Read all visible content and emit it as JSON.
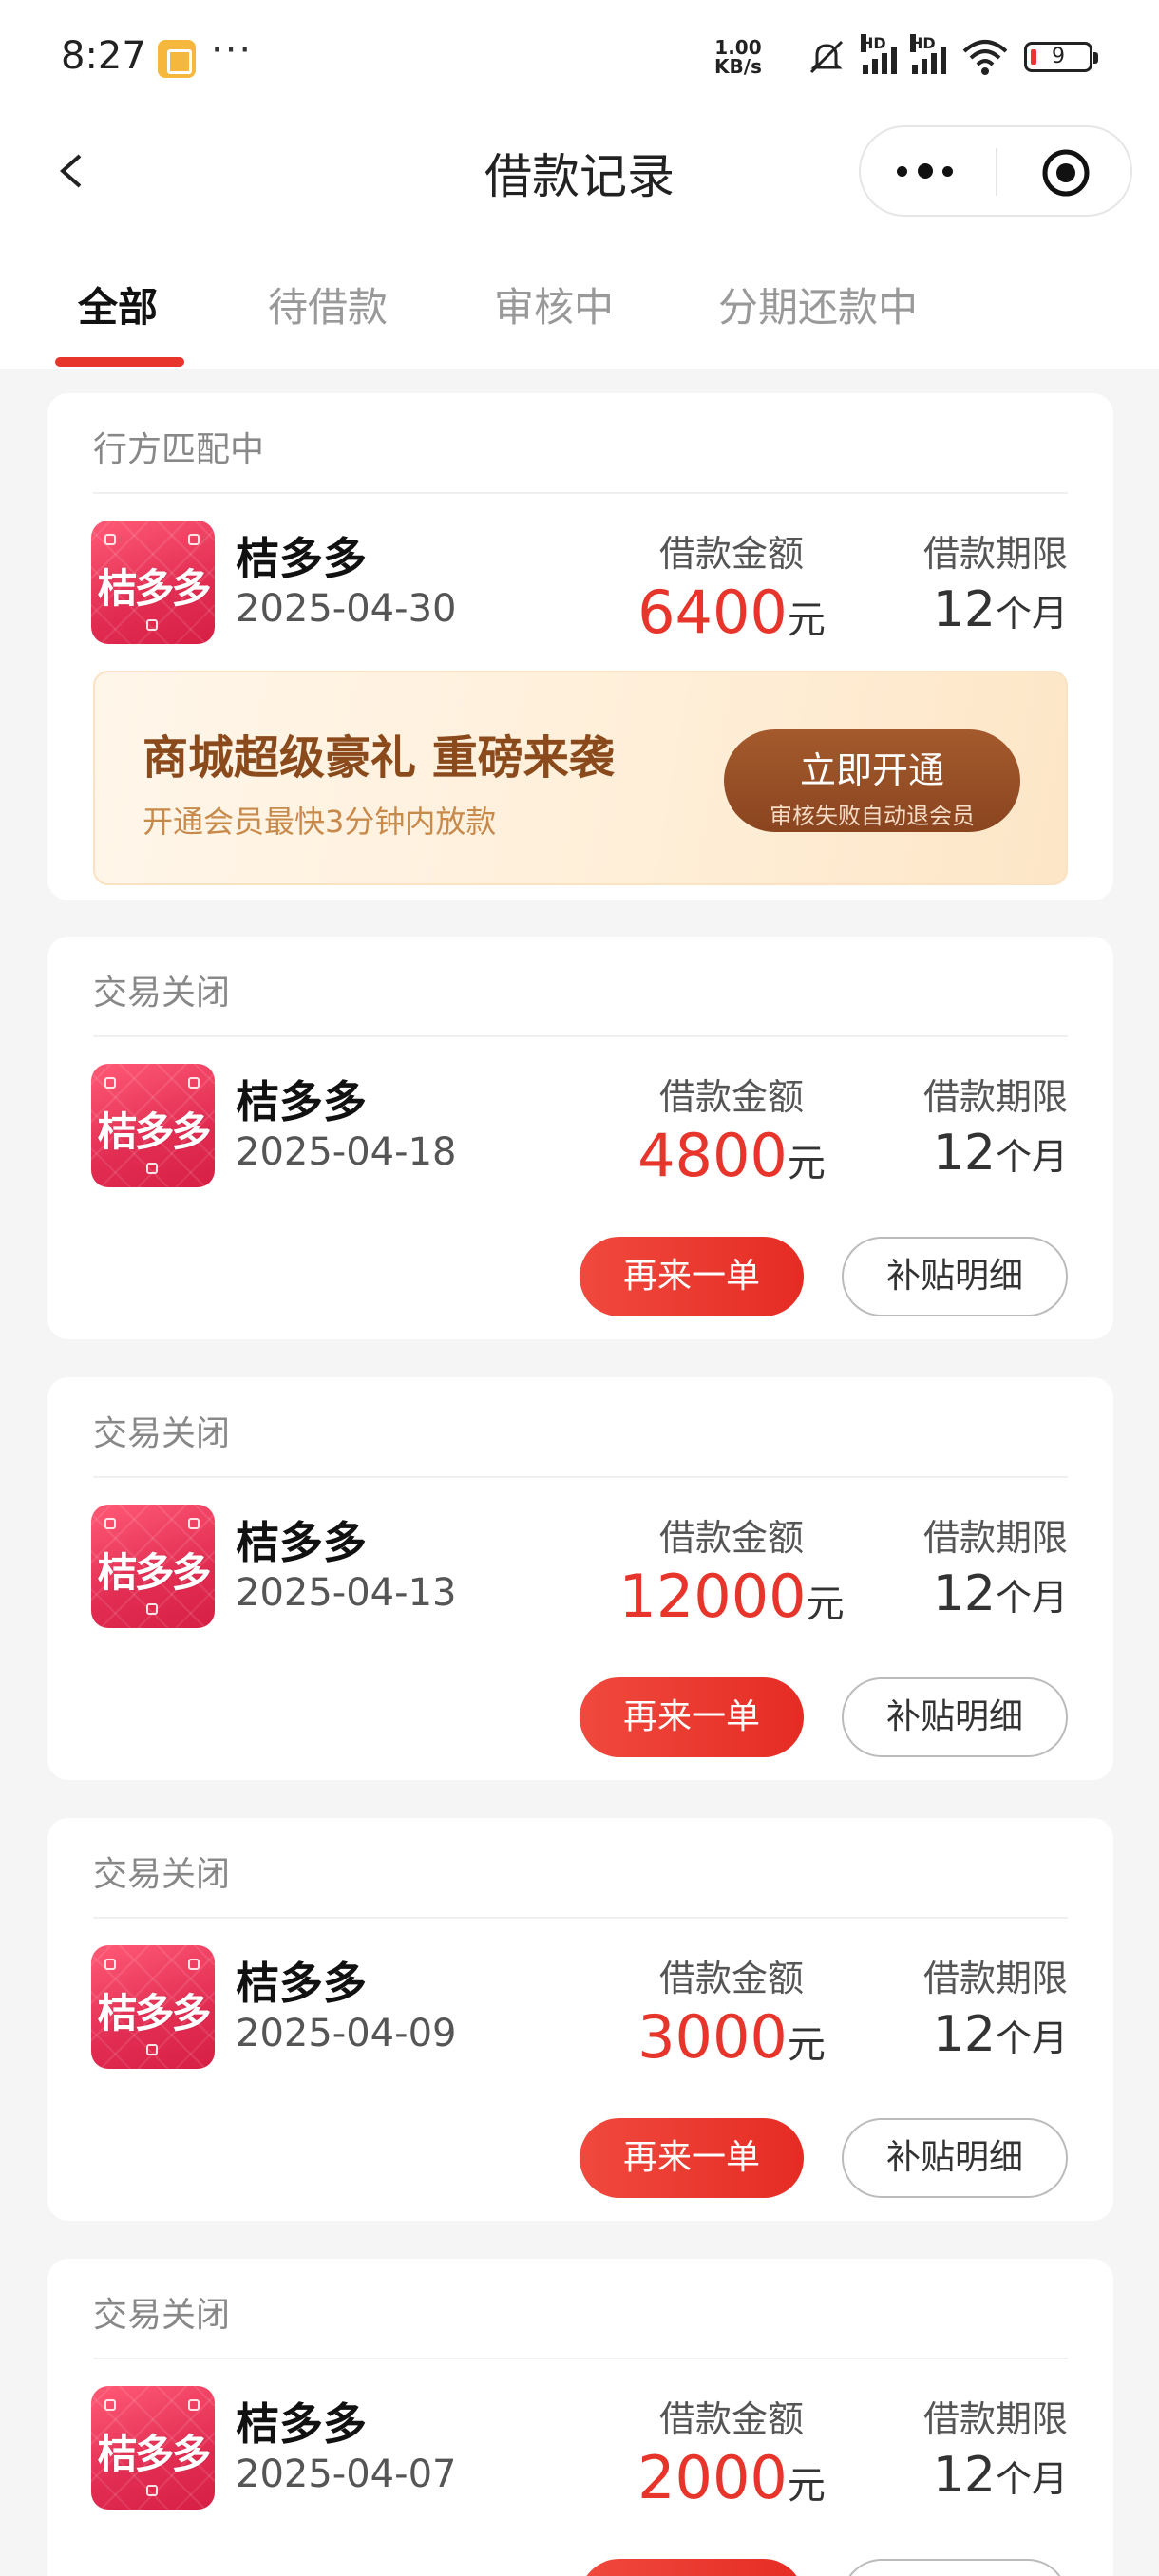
{
  "status_bar": {
    "time": "8:27",
    "more": "···",
    "speed_top": "1.00",
    "speed_bottom": "KB/s",
    "hd1": "HD",
    "hd2": "HD",
    "battery": "9"
  },
  "nav": {
    "title": "借款记录"
  },
  "tabs": [
    {
      "label": "全部",
      "active": true
    },
    {
      "label": "待借款",
      "active": false
    },
    {
      "label": "审核中",
      "active": false
    },
    {
      "label": "分期还款中",
      "active": false
    }
  ],
  "labels": {
    "amount": "借款金额",
    "term": "借款期限",
    "yuan": "元",
    "months": "个月",
    "again": "再来一单",
    "detail": "补贴明细"
  },
  "promo": {
    "title": "商城超级豪礼 重磅来袭",
    "subtitle": "开通会员最快3分钟内放款",
    "button": "立即开通",
    "button_sub": "审核失败自动退会员"
  },
  "records": [
    {
      "status": "行方匹配中",
      "merchant": "桔多多",
      "logo_text": "桔多多",
      "date": "2025-04-30",
      "amount": "6400",
      "term": "12"
    },
    {
      "status": "交易关闭",
      "merchant": "桔多多",
      "logo_text": "桔多多",
      "date": "2025-04-18",
      "amount": "4800",
      "term": "12"
    },
    {
      "status": "交易关闭",
      "merchant": "桔多多",
      "logo_text": "桔多多",
      "date": "2025-04-13",
      "amount": "12000",
      "term": "12"
    },
    {
      "status": "交易关闭",
      "merchant": "桔多多",
      "logo_text": "桔多多",
      "date": "2025-04-09",
      "amount": "3000",
      "term": "12"
    },
    {
      "status": "交易关闭",
      "merchant": "桔多多",
      "logo_text": "桔多多",
      "date": "2025-04-07",
      "amount": "2000",
      "term": "12"
    }
  ],
  "colors": {
    "accent": "#e8352c",
    "logo": "#e22d52",
    "promo_button": "#8a4520"
  }
}
